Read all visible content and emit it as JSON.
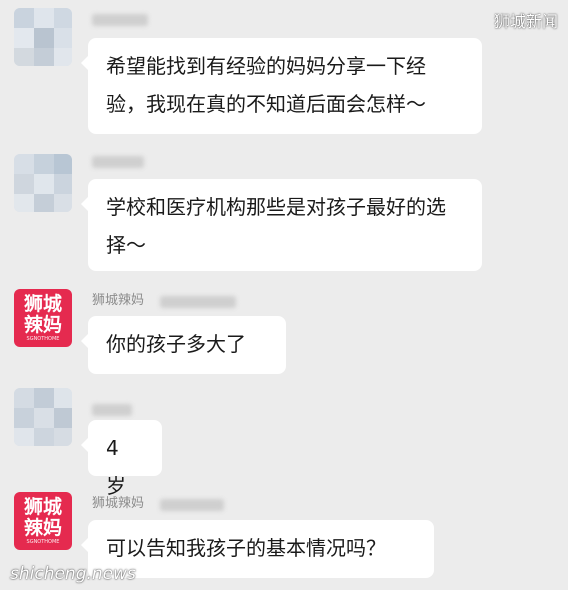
{
  "watermark": {
    "top": "狮城新闻",
    "bottom": "shicheng.news"
  },
  "brand_avatar": {
    "line1": "狮城",
    "line2": "辣妈",
    "sub": "SGNOTHOME"
  },
  "messages": [
    {
      "sender": "",
      "sender_obscured": true,
      "avatar": "blurred",
      "text": "希望能找到有经验的妈妈分享一下经验，我现在真的不知道后面会怎样～"
    },
    {
      "sender": "",
      "sender_obscured": true,
      "avatar": "blurred",
      "text": "学校和医疗机构那些是对孩子最好的选择～"
    },
    {
      "sender": "狮城辣妈",
      "sender_obscured": true,
      "avatar": "brand",
      "text": "你的孩子多大了"
    },
    {
      "sender": "",
      "sender_obscured": true,
      "avatar": "blurred",
      "text": "4 岁"
    },
    {
      "sender": "狮城辣妈",
      "sender_obscured": true,
      "avatar": "brand",
      "text": "可以告知我孩子的基本情况吗？"
    }
  ],
  "colors": {
    "background": "#ececec",
    "bubble": "#ffffff",
    "brand": "#e52a4f",
    "sender_text": "#8c8c8c"
  }
}
